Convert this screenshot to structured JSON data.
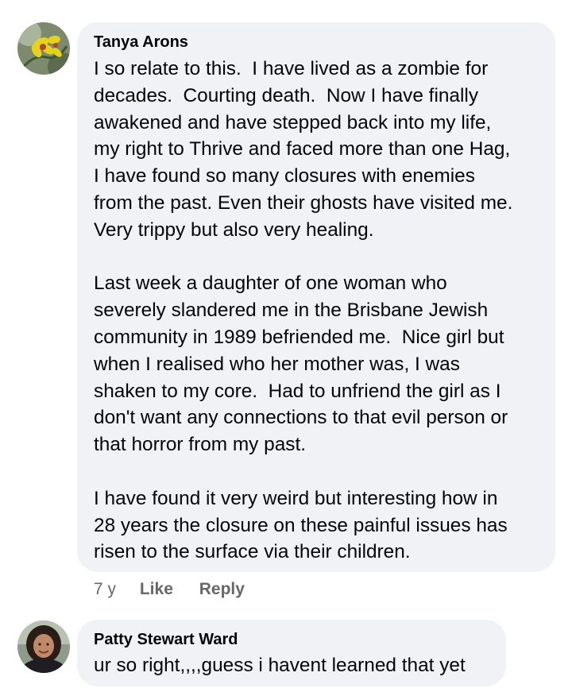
{
  "comments": [
    {
      "author": "Tanya Arons",
      "paragraphs": [
        "I so relate to this.  I have lived as a zombie for\ndecades.  Courting death.  Now I have finally\nawakened and have stepped back into my life,\nmy right to Thrive and faced more than one Hag,\nI have found so many closures with enemies\nfrom the past. Even their ghosts have visited me.\nVery trippy but also very healing.",
        "Last week a daughter of one woman who\nseverely slandered me in the Brisbane Jewish\ncommunity in 1989 befriended me.  Nice girl but\nwhen I realised who her mother was, I was\nshaken to my core.  Had to unfriend the girl as I\ndon't want any connections to that evil person or\nthat horror from my past.",
        "I have found it very weird but interesting how in\n28 years the closure on these painful issues has\nrisen to the surface via their children."
      ],
      "time": "7 y",
      "like_label": "Like",
      "reply_label": "Reply",
      "avatar_icon": "yellow-orchid-avatar"
    },
    {
      "author": "Patty Stewart Ward",
      "paragraphs": [
        "ur so right,,,,guess i havent learned that yet"
      ],
      "avatar_icon": "woman-portrait-avatar"
    }
  ]
}
